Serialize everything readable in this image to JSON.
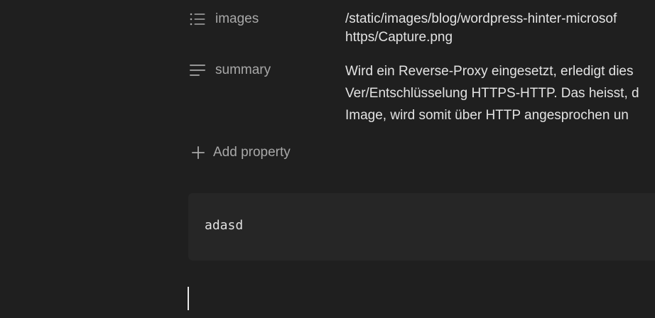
{
  "properties": [
    {
      "icon": "bulleted-list-icon",
      "name": "images",
      "value_lines": [
        "/static/images/blog/wordpress-hinter-microsof",
        "https/Capture.png"
      ]
    },
    {
      "icon": "text-lines-icon",
      "name": "summary",
      "value_lines": [
        "Wird ein Reverse-Proxy eingesetzt, erledigt dies",
        "Ver/Entschlüsselung HTTPS-HTTP. Das heisst, d",
        "Image, wird somit über HTTP angesprochen un"
      ]
    }
  ],
  "add_property": {
    "icon": "plus-icon",
    "label": "Add property"
  },
  "code_block": {
    "text": "adasd"
  },
  "colors": {
    "background": "#1f1f1f",
    "code_background": "#262626",
    "muted_text": "#a8a8a8",
    "value_text": "#e3e3e3"
  }
}
